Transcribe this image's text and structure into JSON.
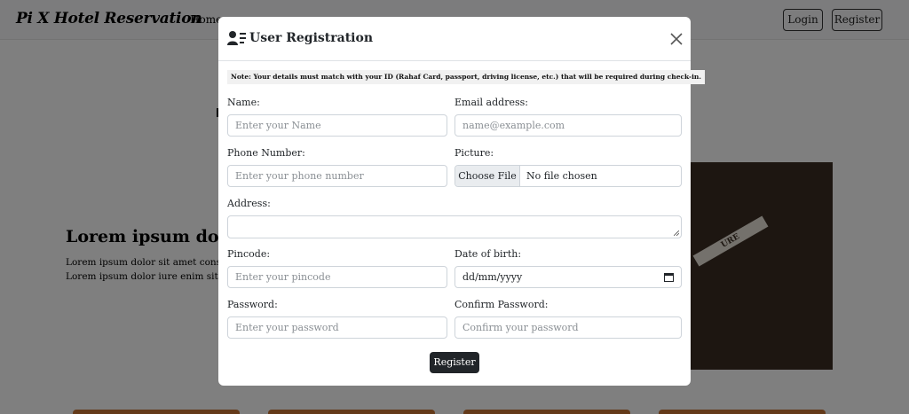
{
  "navbar": {
    "brand": "Pi X Hotel Reservation",
    "home_link": "Home",
    "login_label": "Login",
    "register_label": "Register"
  },
  "hero": {
    "title": "Lorem ipsum dolor s",
    "paragraph": "Lorem ipsum dolor sit amet consect cumque neque? Lorem ipsum dolor iure enim sit cumque neque?",
    "image_caption": "URE"
  },
  "modal": {
    "title": "User Registration",
    "title_icon": "user-list-icon",
    "close_icon": "close-icon",
    "note": "Note: Your details must match with your ID (Rahaf Card, passport, driving license, etc.) that will be required during check-in.",
    "fields": {
      "name": {
        "label": "Name:",
        "placeholder": "Enter your Name"
      },
      "email": {
        "label": "Email address:",
        "placeholder": "name@example.com"
      },
      "phone": {
        "label": "Phone Number:",
        "placeholder": "Enter your phone number"
      },
      "picture": {
        "label": "Picture:",
        "button": "Choose File",
        "status": "No file chosen"
      },
      "address": {
        "label": "Address:",
        "value": ""
      },
      "pincode": {
        "label": "Pincode:",
        "placeholder": "Enter your pincode"
      },
      "dob": {
        "label": "Date of birth:",
        "placeholder": "dd/mm/yyyy",
        "icon": "calendar-icon"
      },
      "password": {
        "label": "Password:",
        "placeholder": "Enter your password"
      },
      "confirm_password": {
        "label": "Confirm Password:",
        "placeholder": "Confirm your password"
      }
    },
    "submit_label": "Register"
  },
  "colors": {
    "backdrop": "rgba(0,0,0,0.5)",
    "primary_button": "#212529",
    "card_accent": "#c87433"
  }
}
